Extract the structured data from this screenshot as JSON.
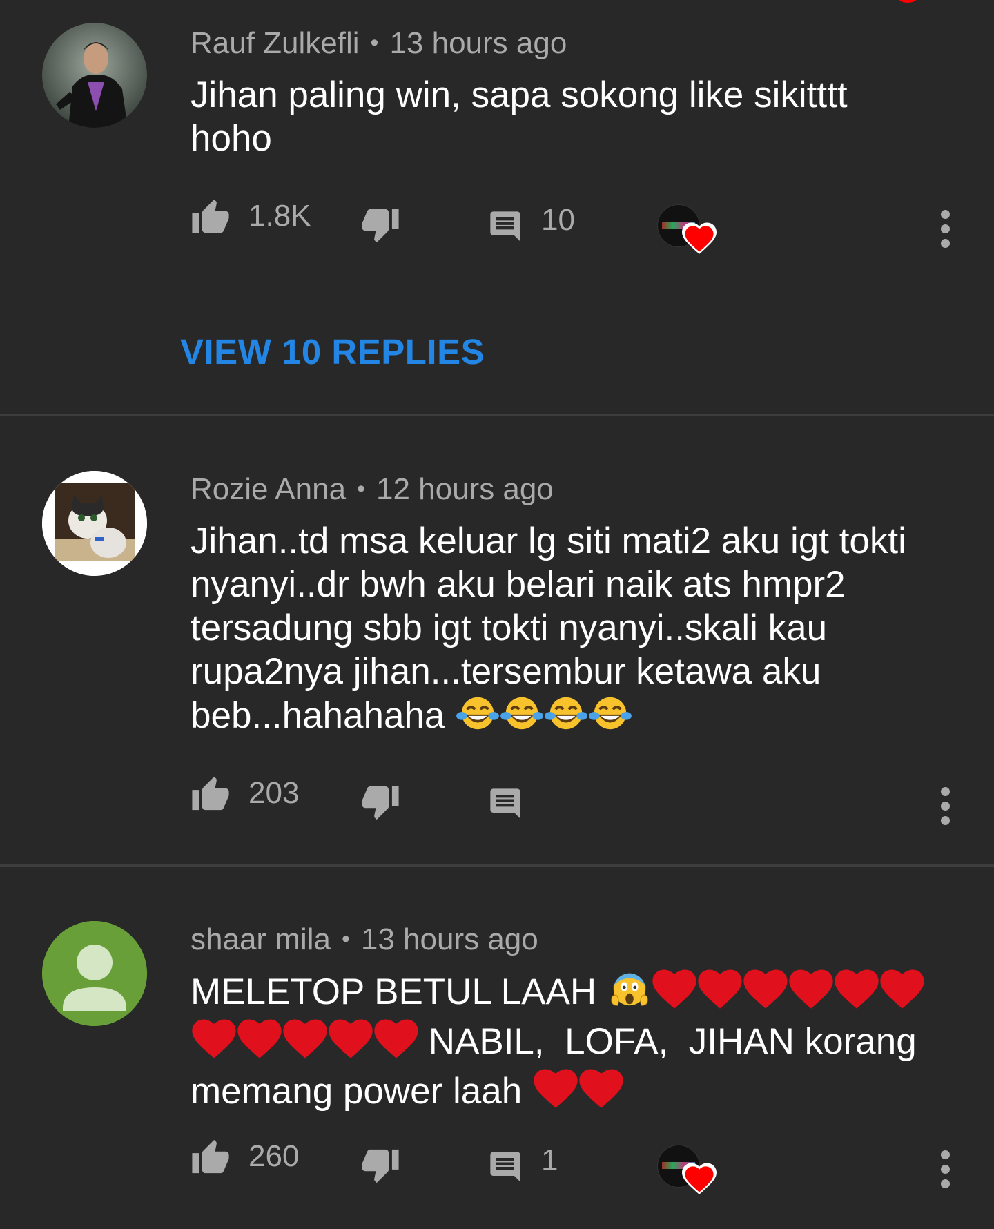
{
  "comments": [
    {
      "author": "Rauf Zulkefli",
      "time": "13 hours ago",
      "text": "Jihan paling win, sapa sokong like sikitttt hoho",
      "likes": "1.8K",
      "replies": "10",
      "view_replies": "VIEW 10 REPLIES",
      "creator_hearted": true
    },
    {
      "author": "Rozie Anna",
      "time": "12 hours ago",
      "text": "Jihan..td msa keluar lg siti mati2 aku igt tokti nyanyi..dr bwh aku belari naik ats hmpr2 tersadung sbb igt tokti nyanyi..skali kau rupa2nya jihan...tersembur ketawa aku beb...hahahaha",
      "likes": "203",
      "replies": "",
      "creator_hearted": false
    },
    {
      "author": "shaar mila",
      "time": "13 hours ago",
      "text_part1": "MELETOP BETUL LAAH",
      "text_part2": "NABIL,  LOFA,  JIHAN korang",
      "text_part3": "memang power laah",
      "likes": "260",
      "replies": "1",
      "creator_hearted": true
    }
  ],
  "colors": {
    "background": "#282828",
    "secondary_text": "#aaaaaa",
    "link_blue": "#2385e4",
    "heart_red": "#ff0000"
  },
  "icons": [
    "like-icon",
    "dislike-icon",
    "reply-icon",
    "creator-heart-icon",
    "more-vert-icon",
    "tears-of-joy-emoji",
    "screaming-emoji",
    "red-heart-emoji"
  ]
}
